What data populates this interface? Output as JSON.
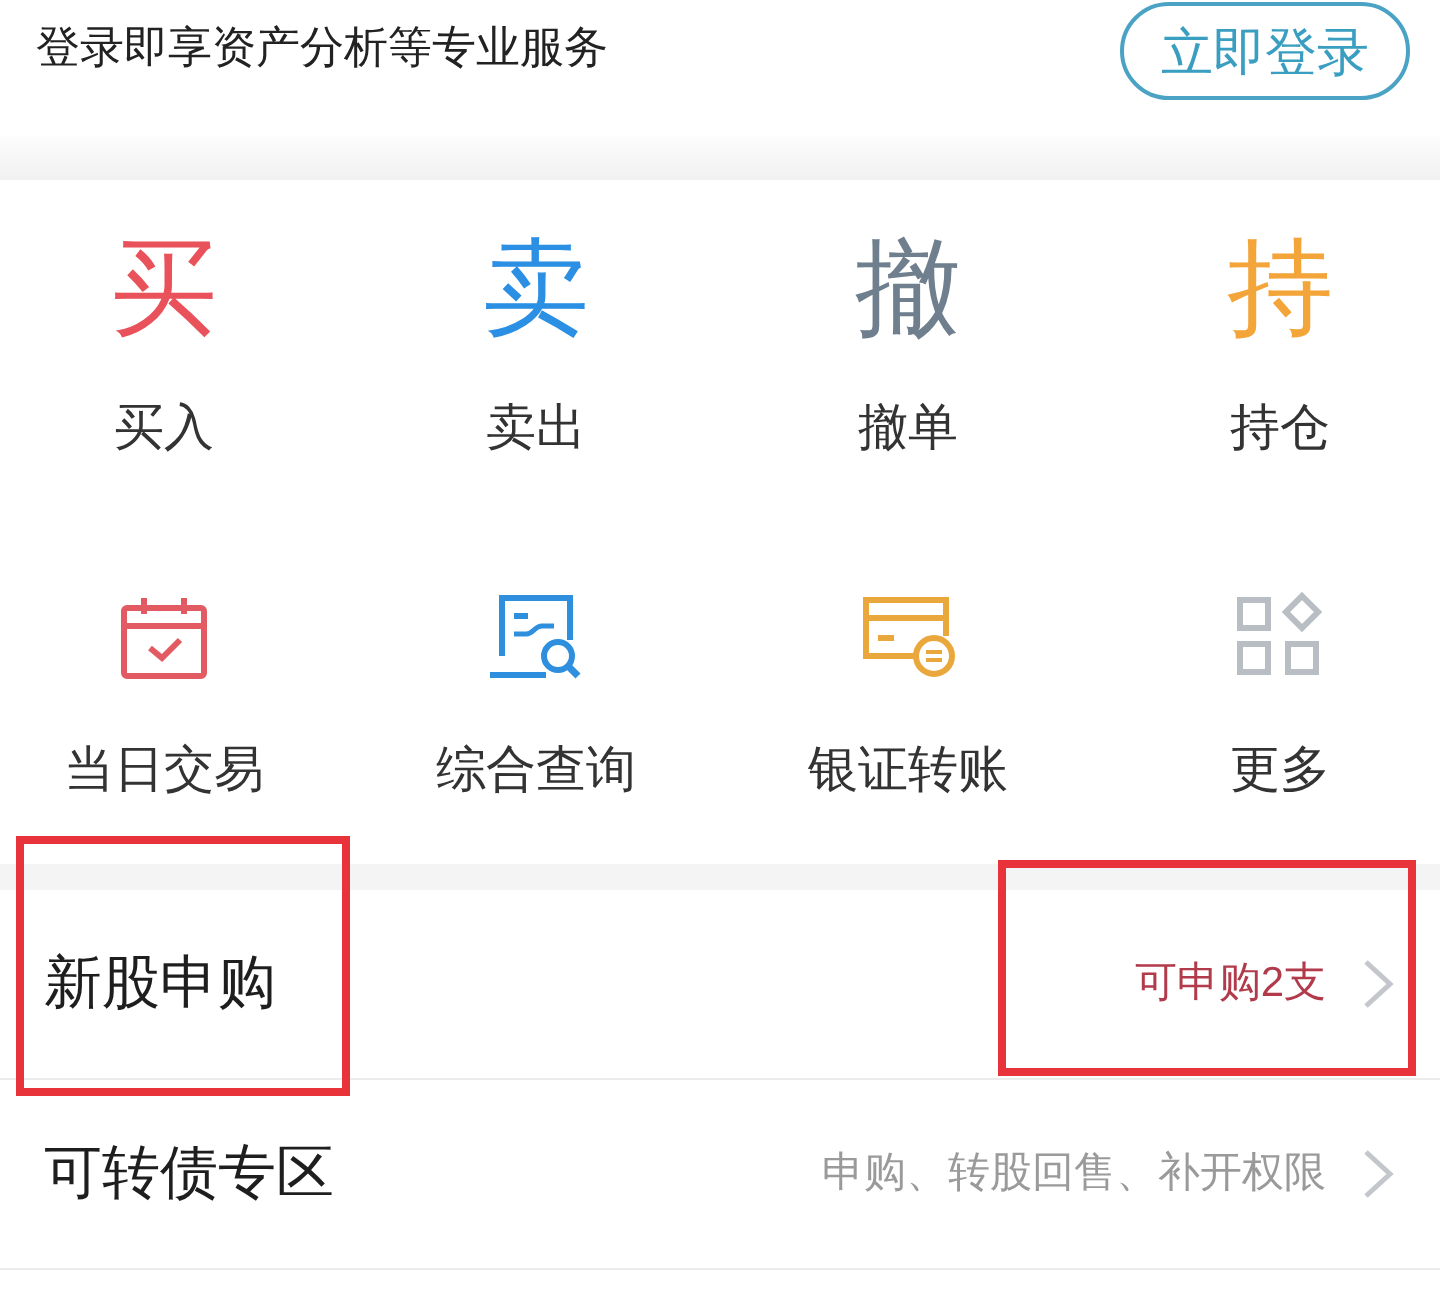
{
  "login_bar": {
    "prompt": "登录即享资产分析等专业服务",
    "login_button": "立即登录"
  },
  "actions": [
    {
      "kind": "glyph",
      "glyph": "买",
      "color": "#e9525a",
      "label": "买入"
    },
    {
      "kind": "glyph",
      "glyph": "卖",
      "color": "#2b8fe3",
      "label": "卖出"
    },
    {
      "kind": "glyph",
      "glyph": "撤",
      "color": "#6f7f8e",
      "label": "撤单"
    },
    {
      "kind": "glyph",
      "glyph": "持",
      "color": "#f3a53a",
      "label": "持仓"
    },
    {
      "kind": "icon",
      "color": "#e25b63",
      "label": "当日交易"
    },
    {
      "kind": "icon",
      "color": "#2e8fde",
      "label": "综合查询"
    },
    {
      "kind": "icon",
      "color": "#eaa83c",
      "label": "银证转账"
    },
    {
      "kind": "icon",
      "color": "#b9bdc4",
      "label": "更多"
    }
  ],
  "rows": [
    {
      "title": "新股申购",
      "title_highlighted": true,
      "detail": "可申购2支",
      "detail_highlighted": true,
      "alert": true
    },
    {
      "title": "可转债专区",
      "title_highlighted": false,
      "detail": "申购、转股回售、补开权限",
      "detail_highlighted": false,
      "alert": false
    }
  ]
}
